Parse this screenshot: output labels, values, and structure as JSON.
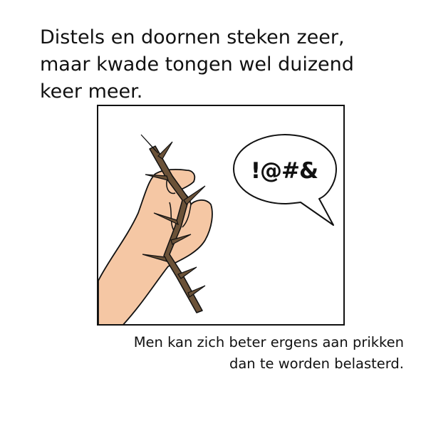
{
  "title": {
    "line1": "Distels en doornen steken zeer,",
    "line2": "maar kwade tongen wel duizend",
    "line3": "keer meer."
  },
  "panel": {
    "speech_bubble_text": "!@#&",
    "icons": [
      "hand-icon",
      "thorny-branch-icon",
      "speech-bubble-icon"
    ]
  },
  "caption": {
    "line1": "Men kan zich beter ergens aan prikken",
    "line2": "dan te worden belasterd."
  },
  "colors": {
    "skin": "#f5c7a4",
    "branch": "#6b5238",
    "outline": "#111111"
  }
}
